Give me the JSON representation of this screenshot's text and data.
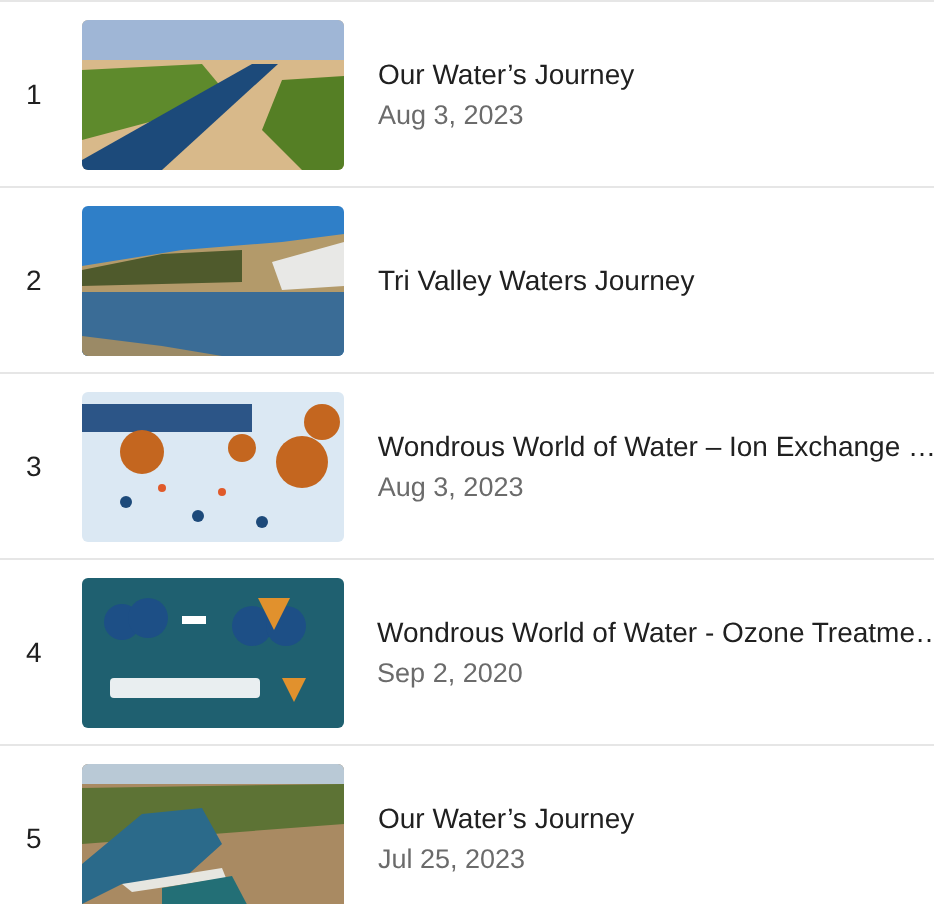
{
  "videos": [
    {
      "number": "1",
      "title": "Our Water’s Journey",
      "date": "Aug 3, 2023"
    },
    {
      "number": "2",
      "title": "Tri Valley Waters Journey"
    },
    {
      "number": "3",
      "title": "Wondrous World of Water – Ion Exchange …",
      "date": "Aug 3, 2023"
    },
    {
      "number": "4",
      "title": "Wondrous World of Water - Ozone Treatme…",
      "date": "Sep 2, 2020"
    },
    {
      "number": "5",
      "title": "Our Water’s Journey",
      "date": "Jul 25, 2023"
    }
  ]
}
